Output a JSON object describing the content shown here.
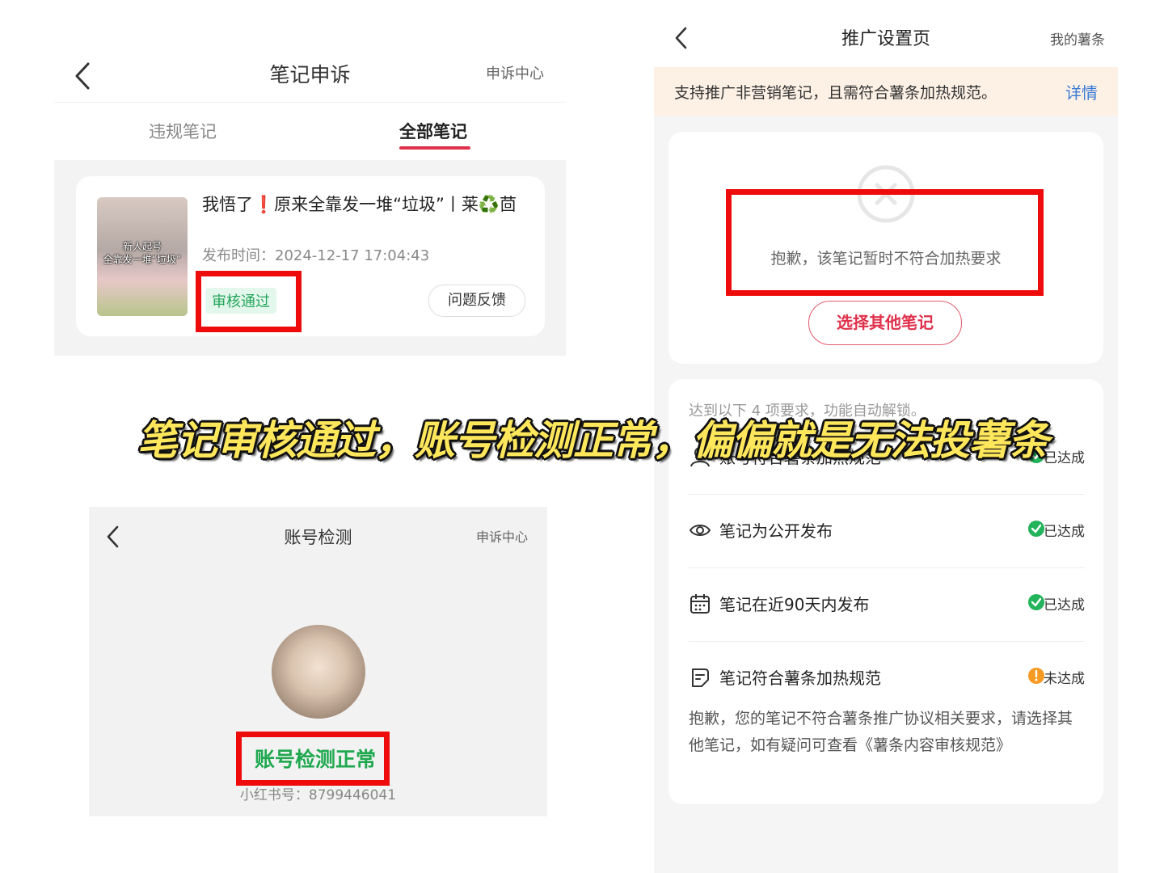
{
  "appeal": {
    "title": "笔记申诉",
    "right_link": "申诉中心",
    "tabs": [
      {
        "label": "违规笔记",
        "active": false
      },
      {
        "label": "全部笔记",
        "active": true
      }
    ],
    "note": {
      "title": "我悟了❗原来全靠发一堆“垃圾”丨莱♻️茴",
      "thumb_caption_1": "新人起号",
      "thumb_caption_2": "全靠发一堆“垃圾”",
      "publish_time": "发布时间：2024-12-17 17:04:43",
      "status": "审核通过",
      "feedback_button": "问题反馈"
    }
  },
  "account_check": {
    "title": "账号检测",
    "right_link": "申诉中心",
    "status": "账号检测正常",
    "account_id": "小红书号：8799446041"
  },
  "promotion": {
    "title": "推广设置页",
    "right_link": "我的薯条",
    "notice": "支持推广非营销笔记，且需符合薯条加热规范。",
    "notice_link": "详情",
    "fail_message": "抱歉，该笔记暂时不符合加热要求",
    "choose_button": "选择其他笔记",
    "requirements_intro": "达到以下 4 项要求，功能自动解锁。",
    "requirements": [
      {
        "label": "账号符合薯条加热规范",
        "status": "已达成",
        "icon": "user-icon",
        "ok": true
      },
      {
        "label": "笔记为公开发布",
        "status": "已达成",
        "icon": "eye-icon",
        "ok": true
      },
      {
        "label": "笔记在近90天内发布",
        "status": "已达成",
        "icon": "calendar-icon",
        "ok": true
      },
      {
        "label": "笔记符合薯条加热规范",
        "status": "未达成",
        "icon": "document-icon",
        "ok": false
      }
    ],
    "requirement_note": "抱歉，您的笔记不符合薯条推广协议相关要求，请选择其他笔记，如有疑问可查看《薯条内容审核规范》"
  },
  "caption": "笔记审核通过，账号检测正常，偏偏就是无法投薯条",
  "colors": {
    "accent_red": "#e0304b",
    "highlight_box": "#ee0b0b",
    "success_green": "#22b35b",
    "warning_orange": "#f59a23",
    "link_blue": "#3a7bd5",
    "caption_yellow": "#ffe75c"
  }
}
